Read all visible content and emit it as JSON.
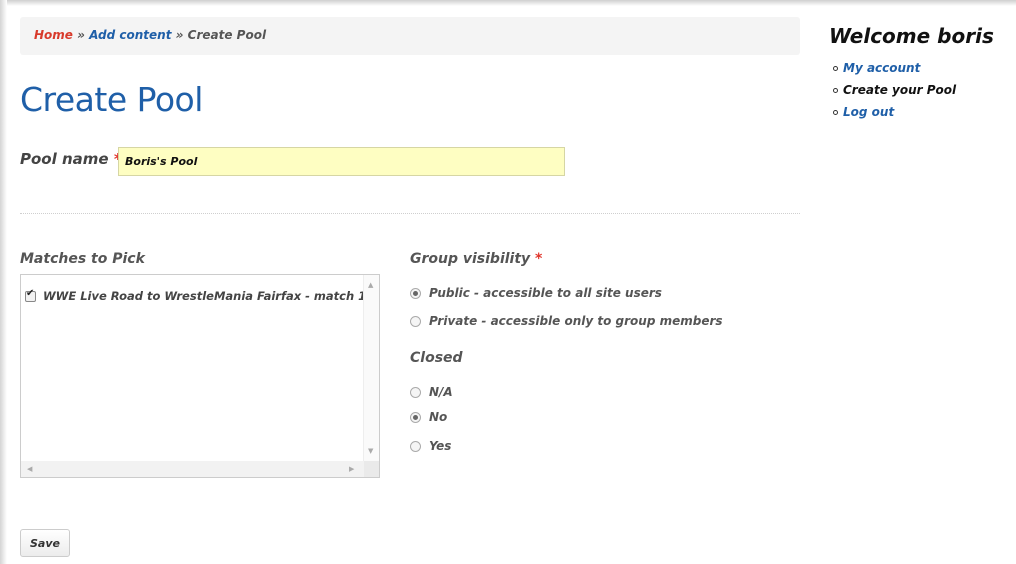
{
  "breadcrumb": {
    "home": "Home",
    "sep": "»",
    "add_content": "Add content",
    "current": "Create Pool"
  },
  "page": {
    "title": "Create Pool"
  },
  "pool_name": {
    "label": "Pool name",
    "required": "*",
    "value": "Boris's Pool"
  },
  "matches": {
    "label": "Matches to Pick",
    "items": [
      {
        "label": "WWE Live Road to WrestleMania Fairfax - match 1",
        "checked": true
      }
    ]
  },
  "visibility": {
    "label": "Group visibility",
    "required": "*",
    "options": [
      {
        "label": "Public - accessible to all site users",
        "checked": true
      },
      {
        "label": "Private - accessible only to group members",
        "checked": false
      }
    ]
  },
  "closed": {
    "label": "Closed",
    "options": [
      {
        "label": "N/A",
        "checked": false
      },
      {
        "label": "No",
        "checked": true
      },
      {
        "label": "Yes",
        "checked": false
      }
    ]
  },
  "save_label": "Save",
  "sidebar": {
    "welcome": "Welcome boris",
    "links": [
      {
        "label": "My account",
        "active": false
      },
      {
        "label": "Create your Pool",
        "active": true
      },
      {
        "label": "Log out",
        "active": false
      }
    ]
  },
  "colors": {
    "link_blue": "#1f5fa8",
    "home_red": "#d83a2b",
    "required_red": "#e0352b",
    "input_yellow": "#fefec2"
  }
}
